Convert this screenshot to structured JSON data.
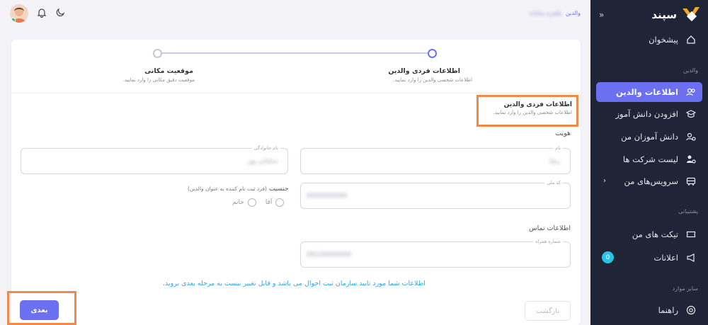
{
  "sidebar": {
    "logo": "سپند",
    "items": [
      {
        "label": "پیشخوان",
        "icon": "home-icon"
      },
      {
        "label": "اطلاعات والدین",
        "icon": "users-icon",
        "active": true
      },
      {
        "label": "افزودن دانش آموز",
        "icon": "graduation-cap-icon"
      },
      {
        "label": "دانش آموزان من",
        "icon": "students-icon"
      },
      {
        "label": "لیست شرکت ها",
        "icon": "company-list-icon"
      },
      {
        "label": "سرویس‌های من",
        "icon": "bus-icon"
      },
      {
        "label": "تیکت های من",
        "icon": "ticket-icon"
      },
      {
        "label": "اعلانات",
        "icon": "megaphone-icon",
        "badge": "0"
      },
      {
        "label": "راهنما",
        "icon": "lifebuoy-icon"
      }
    ],
    "sections": {
      "parents": "والدین",
      "support": "پشتیبانی",
      "other": "سایر موارد"
    }
  },
  "breadcrumb": {
    "current": "والدین",
    "previous": "پلتفرم سامانه"
  },
  "stepper": {
    "step1": {
      "title": "اطلاعات فردی والدین",
      "subtitle": "اطلاعات شخصی والدین را وارد نمایید."
    },
    "step2": {
      "title": "موقعیت مکانی",
      "subtitle": "موقعیت دقیق مکانی را وارد نمایید."
    }
  },
  "section": {
    "title": "اطلاعات فردی والدین",
    "subtitle": "اطلاعات شخصی والدین را وارد نمایید."
  },
  "identity": {
    "heading": "هویت",
    "first_name": {
      "label": "نام",
      "value": "رضا"
    },
    "last_name": {
      "label": "نام خانوادگی",
      "value": "سامانی پور"
    },
    "national_code": {
      "label": "کد ملی",
      "value": "0000000000"
    },
    "gender": {
      "label": "جنسیت",
      "hint": "(فرد ثبت نام کننده به عنوان والدین)",
      "male": "آقا",
      "female": "خانم"
    }
  },
  "contact": {
    "heading": "اطلاعات تماس",
    "phone": {
      "label": "شماره همراه",
      "value": "09120000000"
    }
  },
  "note": "اطلاعات شما مورد تایید سازمان ثبت احوال می باشد و قابل تغییر نیست به مرحله بعدی بروید.",
  "buttons": {
    "next": "بعدی",
    "back": "بازگشت"
  },
  "colors": {
    "accent": "#6b70f1",
    "sidebar": "#1f2536",
    "highlight": "#f08a4b",
    "note": "#35a7e0"
  }
}
